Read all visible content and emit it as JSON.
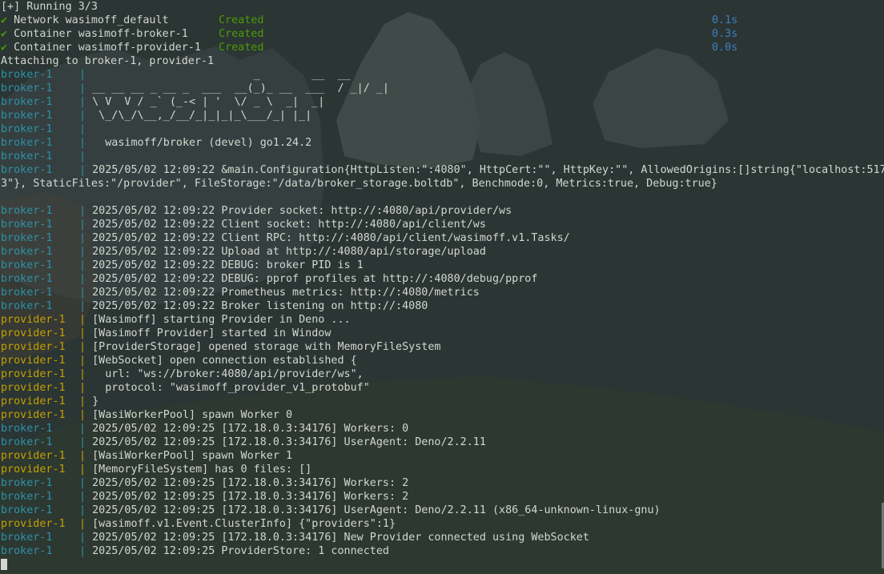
{
  "header": {
    "running": "[+] Running 3/3",
    "rows": [
      {
        "check": "✔",
        "name": "Network wasimoff_default",
        "status": "Created",
        "time": "0.1s"
      },
      {
        "check": "✔",
        "name": "Container wasimoff-broker-1",
        "status": "Created",
        "time": "0.3s"
      },
      {
        "check": "✔",
        "name": "Container wasimoff-provider-1",
        "status": "Created",
        "time": "0.0s"
      }
    ],
    "attaching": "Attaching to broker-1, provider-1"
  },
  "labels": {
    "broker": "broker-1",
    "provider": "provider-1",
    "sep": "|"
  },
  "banner": [
    "                          _        __  __ ",
    " __ __ __ _ __ _  ___  __(_)_ __  ___  / _|/ _|",
    " \\ V  V / _` (_-< | '  \\/ _ \\  _|  _|",
    "  \\_/\\_/\\__,_/__/_|_|_|_\\___/_| |_|  ",
    "",
    "   wasimoff/broker (devel) go1.24.2",
    ""
  ],
  "config_line": " 2025/05/02 12:09:22 &main.Configuration{HttpListen:\":4080\", HttpCert:\"\", HttpKey:\"\", AllowedOrigins:[]string{\"localhost:517",
  "config_wrap": "3\"}, StaticFiles:\"/provider\", FileStorage:\"/data/broker_storage.boltdb\", Benchmode:0, Metrics:true, Debug:true}",
  "log": [
    {
      "src": "broker",
      "text": " 2025/05/02 12:09:22 Provider socket: http://:4080/api/provider/ws"
    },
    {
      "src": "broker",
      "text": " 2025/05/02 12:09:22 Client socket: http://:4080/api/client/ws"
    },
    {
      "src": "broker",
      "text": " 2025/05/02 12:09:22 Client RPC: http://:4080/api/client/wasimoff.v1.Tasks/"
    },
    {
      "src": "broker",
      "text": " 2025/05/02 12:09:22 Upload at http://:4080/api/storage/upload"
    },
    {
      "src": "broker",
      "text": " 2025/05/02 12:09:22 DEBUG: broker PID is 1"
    },
    {
      "src": "broker",
      "text": " 2025/05/02 12:09:22 DEBUG: pprof profiles at http://:4080/debug/pprof"
    },
    {
      "src": "broker",
      "text": " 2025/05/02 12:09:22 Prometheus metrics: http://:4080/metrics"
    },
    {
      "src": "broker",
      "text": " 2025/05/02 12:09:22 Broker listening on http://:4080"
    },
    {
      "src": "provider",
      "text": " [Wasimoff] starting Provider in Deno ..."
    },
    {
      "src": "provider",
      "text": " [Wasimoff Provider] started in Window"
    },
    {
      "src": "provider",
      "text": " [ProviderStorage] opened storage with MemoryFileSystem"
    },
    {
      "src": "provider",
      "text": " [WebSocket] open connection established {"
    },
    {
      "src": "provider",
      "text": "   url: \"ws://broker:4080/api/provider/ws\","
    },
    {
      "src": "provider",
      "text": "   protocol: \"wasimoff_provider_v1_protobuf\""
    },
    {
      "src": "provider",
      "text": " }"
    },
    {
      "src": "provider",
      "text": " [WasiWorkerPool] spawn Worker 0"
    },
    {
      "src": "broker",
      "text": " 2025/05/02 12:09:25 [172.18.0.3:34176] Workers: 0"
    },
    {
      "src": "broker",
      "text": " 2025/05/02 12:09:25 [172.18.0.3:34176] UserAgent: Deno/2.2.11"
    },
    {
      "src": "provider",
      "text": " [WasiWorkerPool] spawn Worker 1"
    },
    {
      "src": "provider",
      "text": " [MemoryFileSystem] has 0 files: []"
    },
    {
      "src": "broker",
      "text": " 2025/05/02 12:09:25 [172.18.0.3:34176] Workers: 2"
    },
    {
      "src": "broker",
      "text": " 2025/05/02 12:09:25 [172.18.0.3:34176] Workers: 2"
    },
    {
      "src": "broker",
      "text": " 2025/05/02 12:09:25 [172.18.0.3:34176] UserAgent: Deno/2.2.11 (x86_64-unknown-linux-gnu)"
    },
    {
      "src": "provider",
      "text": " [wasimoff.v1.Event.ClusterInfo] {\"providers\":1}"
    },
    {
      "src": "broker",
      "text": " 2025/05/02 12:09:25 [172.18.0.3:34176] New Provider connected using WebSocket"
    },
    {
      "src": "broker",
      "text": " 2025/05/02 12:09:25 ProviderStore: 1 connected"
    }
  ],
  "colors": {
    "broker": "#2e91a8",
    "provider": "#c4a000",
    "created": "#4e9a06",
    "time": "#3d7fbf",
    "text": "#d3d7cf"
  }
}
